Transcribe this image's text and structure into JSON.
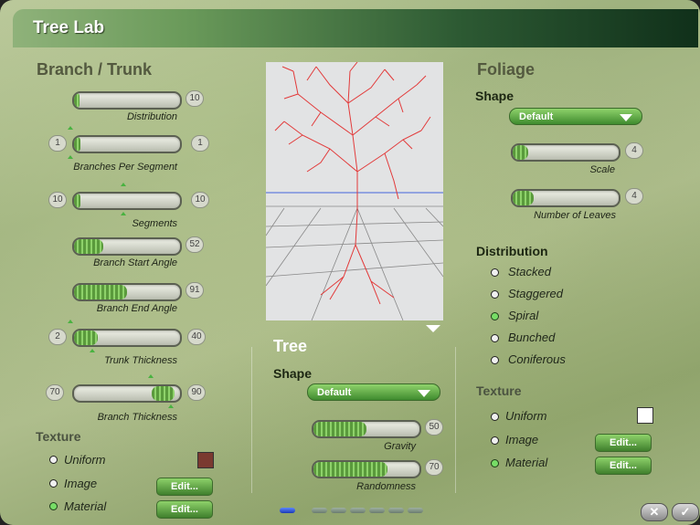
{
  "window": {
    "title": "Tree Lab"
  },
  "branch": {
    "heading": "Branch / Trunk",
    "sliders": [
      {
        "label": "Distribution",
        "left_value": "",
        "right_value": "10",
        "fill": 0.05
      },
      {
        "label": "Branches Per Segment",
        "left_value": "1",
        "right_value": "1",
        "fill": 0.0
      },
      {
        "label": "Segments",
        "left_value": "10",
        "right_value": "10",
        "fill": 0.0
      },
      {
        "label": "Branch Start Angle",
        "left_value": "",
        "right_value": "52",
        "fill": 0.28
      },
      {
        "label": "Branch End Angle",
        "left_value": "",
        "right_value": "91",
        "fill": 0.5
      },
      {
        "label": "Trunk Thickness",
        "left_value": "2",
        "right_value": "40",
        "fill": 0.22
      },
      {
        "label": "Branch Thickness",
        "left_value": "70",
        "right_value": "90",
        "fill": 0.22
      }
    ],
    "texture": {
      "heading": "Texture",
      "options": [
        "Uniform",
        "Image",
        "Material"
      ],
      "selected": "Material",
      "swatch_color": "#7a3a30",
      "edit_label": "Edit..."
    }
  },
  "tree": {
    "heading": "Tree",
    "shape_heading": "Shape",
    "shape_value": "Default",
    "sliders": [
      {
        "label": "Gravity",
        "right_value": "50",
        "fill": 0.5
      },
      {
        "label": "Randomness",
        "right_value": "70",
        "fill": 0.7
      }
    ]
  },
  "foliage": {
    "heading": "Foliage",
    "shape_heading": "Shape",
    "shape_value": "Default",
    "sliders": [
      {
        "label": "Scale",
        "right_value": "4",
        "fill": 0.15
      },
      {
        "label": "Number of Leaves",
        "right_value": "4",
        "fill": 0.2
      }
    ],
    "distribution": {
      "heading": "Distribution",
      "options": [
        "Stacked",
        "Staggered",
        "Spiral",
        "Bunched",
        "Coniferous"
      ],
      "selected": "Spiral"
    },
    "texture": {
      "heading": "Texture",
      "options": [
        "Uniform",
        "Image",
        "Material"
      ],
      "selected": "Material",
      "swatch_color": "#ffffff",
      "edit_label": "Edit..."
    }
  },
  "footer": {
    "page_count": 7,
    "active_page": 1,
    "cancel_icon": "x-icon",
    "ok_icon": "check-icon"
  },
  "colors": {
    "accent": "#5fb840",
    "branch_line": "#e23a3a",
    "horizon": "#4466dd"
  }
}
